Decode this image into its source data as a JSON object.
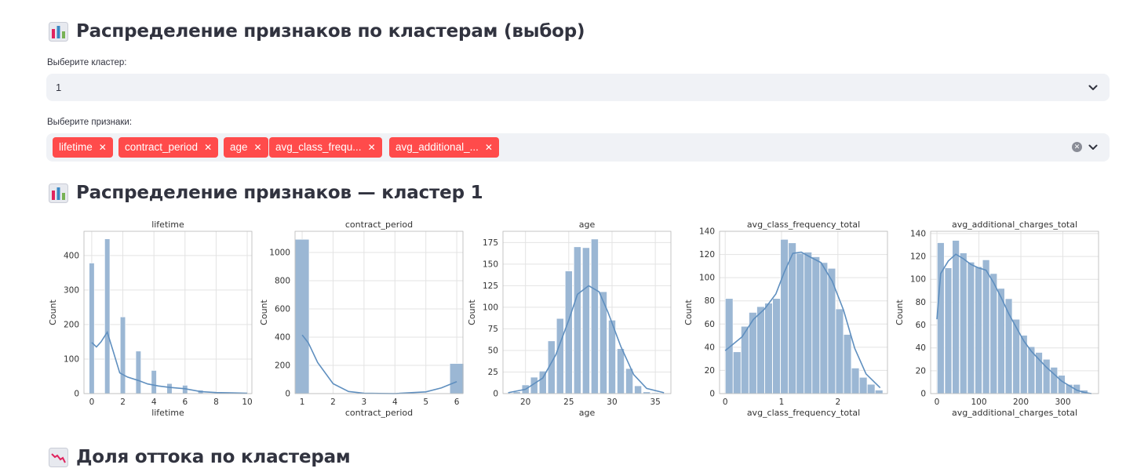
{
  "section1": {
    "title": "Распределение признаков по кластерам (выбор)",
    "icon": "bar-chart-icon"
  },
  "cluster_select": {
    "label": "Выберите кластер:",
    "value": "1"
  },
  "features_select": {
    "label": "Выберите признаки:",
    "tags": [
      "lifetime",
      "contract_period",
      "age",
      "avg_class_frequ...",
      "avg_additional_..."
    ]
  },
  "section2": {
    "title": "Распределение признаков — кластер 1",
    "icon": "bar-chart-icon"
  },
  "section3": {
    "title": "Доля оттока по кластерам",
    "icon": "chart-decreasing-icon"
  },
  "colors": {
    "accent": "#ff4b4b",
    "bar": "#9bb7d4",
    "kde": "#5f8fbf",
    "select_bg": "#f0f2f6"
  },
  "chart_data": [
    {
      "type": "bar",
      "title": "lifetime",
      "xlabel": "lifetime",
      "ylabel": "Count",
      "xlim": [
        -0.5,
        10.3
      ],
      "ylim": [
        0,
        470
      ],
      "xticks": [
        0,
        2,
        4,
        6,
        8,
        10
      ],
      "yticks": [
        0,
        100,
        200,
        300,
        400
      ],
      "bar_width": 0.33,
      "x": [
        0,
        1,
        2,
        3,
        4,
        5,
        6,
        7,
        8,
        9
      ],
      "values": [
        378,
        448,
        222,
        123,
        67,
        29,
        24,
        10,
        2,
        1
      ],
      "kde": [
        [
          0,
          148
        ],
        [
          0.3,
          135
        ],
        [
          0.6,
          150
        ],
        [
          1,
          178
        ],
        [
          1.4,
          120
        ],
        [
          1.8,
          60
        ],
        [
          2.3,
          48
        ],
        [
          3,
          38
        ],
        [
          3.6,
          28
        ],
        [
          4.3,
          22
        ],
        [
          5,
          18
        ],
        [
          6,
          14
        ],
        [
          7,
          6
        ],
        [
          8,
          3
        ],
        [
          9,
          2
        ],
        [
          10,
          1
        ]
      ]
    },
    {
      "type": "bar",
      "title": "contract_period",
      "xlabel": "contract_period",
      "ylabel": "Count",
      "xlim": [
        0.77,
        6.2
      ],
      "ylim": [
        0,
        1150
      ],
      "xticks": [
        1,
        2,
        3,
        4,
        5,
        6
      ],
      "yticks": [
        0,
        200,
        400,
        600,
        800,
        1000
      ],
      "bar_width": 0.45,
      "x": [
        1,
        6
      ],
      "values": [
        1093,
        213
      ],
      "kde": [
        [
          1,
          415
        ],
        [
          1.2,
          360
        ],
        [
          1.5,
          220
        ],
        [
          2,
          70
        ],
        [
          2.5,
          15
        ],
        [
          3,
          2
        ],
        [
          4,
          0
        ],
        [
          5,
          12
        ],
        [
          5.5,
          40
        ],
        [
          6,
          85
        ]
      ]
    },
    {
      "type": "bar",
      "title": "age",
      "xlabel": "age",
      "ylabel": "Count",
      "xlim": [
        17.4,
        36.8
      ],
      "ylim": [
        0,
        188
      ],
      "xticks": [
        20,
        25,
        30,
        35
      ],
      "yticks": [
        0,
        25,
        50,
        75,
        100,
        125,
        150,
        175
      ],
      "bar_width": 0.82,
      "x": [
        19,
        20,
        21,
        22,
        23,
        24,
        25,
        26,
        27,
        28,
        29,
        30,
        31,
        32,
        33,
        34,
        35
      ],
      "values": [
        2,
        10,
        19,
        26,
        61,
        87,
        142,
        170,
        169,
        179,
        118,
        85,
        52,
        29,
        9,
        2,
        1
      ],
      "kde": [
        [
          18,
          1
        ],
        [
          20,
          5
        ],
        [
          22,
          18
        ],
        [
          23.5,
          45
        ],
        [
          25,
          85
        ],
        [
          26,
          115
        ],
        [
          27.3,
          125
        ],
        [
          28.5,
          118
        ],
        [
          29.5,
          95
        ],
        [
          31,
          55
        ],
        [
          32.5,
          22
        ],
        [
          34,
          6
        ],
        [
          36,
          1
        ]
      ]
    },
    {
      "type": "bar",
      "title": "avg_class_frequency_total",
      "xlabel": "avg_class_frequency_total",
      "ylabel": "Count",
      "xlim": [
        -0.1,
        2.88
      ],
      "ylim": [
        0,
        140
      ],
      "xticks": [
        0,
        1,
        2
      ],
      "yticks": [
        0,
        20,
        40,
        60,
        80,
        100,
        120,
        140
      ],
      "bar_width": 0.135,
      "x": [
        0.07,
        0.21,
        0.35,
        0.49,
        0.63,
        0.77,
        0.91,
        1.05,
        1.19,
        1.33,
        1.47,
        1.61,
        1.75,
        1.89,
        2.03,
        2.17,
        2.31,
        2.45,
        2.59,
        2.73
      ],
      "values": [
        82,
        36,
        58,
        70,
        75,
        78,
        82,
        133,
        130,
        121,
        122,
        118,
        113,
        108,
        73,
        51,
        22,
        14,
        8,
        3
      ],
      "kde": [
        [
          0,
          37
        ],
        [
          0.15,
          43
        ],
        [
          0.3,
          49
        ],
        [
          0.5,
          64
        ],
        [
          0.7,
          73
        ],
        [
          0.9,
          86
        ],
        [
          1.05,
          105
        ],
        [
          1.2,
          121
        ],
        [
          1.35,
          122
        ],
        [
          1.5,
          118
        ],
        [
          1.7,
          113
        ],
        [
          1.9,
          97
        ],
        [
          2.1,
          72
        ],
        [
          2.3,
          39
        ],
        [
          2.5,
          17
        ],
        [
          2.75,
          5
        ]
      ]
    },
    {
      "type": "bar",
      "title": "avg_additional_charges_total",
      "xlabel": "avg_additional_charges_total",
      "ylabel": "Count",
      "xlim": [
        -15,
        385
      ],
      "ylim": [
        0,
        142
      ],
      "xticks": [
        0,
        100,
        200,
        300
      ],
      "yticks": [
        0,
        20,
        40,
        60,
        80,
        100,
        120,
        140
      ],
      "bar_width": 16.5,
      "x": [
        9,
        27,
        45,
        63,
        81,
        99,
        117,
        135,
        153,
        171,
        189,
        207,
        225,
        243,
        261,
        279,
        297,
        315,
        333,
        351
      ],
      "values": [
        132,
        110,
        134,
        123,
        115,
        111,
        117,
        105,
        92,
        83,
        65,
        51,
        41,
        36,
        30,
        23,
        16,
        8,
        8,
        3
      ],
      "kde": [
        [
          0,
          65
        ],
        [
          9,
          105
        ],
        [
          27,
          116
        ],
        [
          45,
          122
        ],
        [
          63,
          118
        ],
        [
          81,
          113
        ],
        [
          99,
          110
        ],
        [
          117,
          108
        ],
        [
          135,
          97
        ],
        [
          153,
          84
        ],
        [
          171,
          70
        ],
        [
          189,
          58
        ],
        [
          207,
          46
        ],
        [
          225,
          37
        ],
        [
          243,
          30
        ],
        [
          261,
          23
        ],
        [
          279,
          17
        ],
        [
          297,
          11
        ],
        [
          315,
          7
        ],
        [
          333,
          3
        ],
        [
          351,
          1
        ],
        [
          368,
          0
        ]
      ]
    }
  ]
}
